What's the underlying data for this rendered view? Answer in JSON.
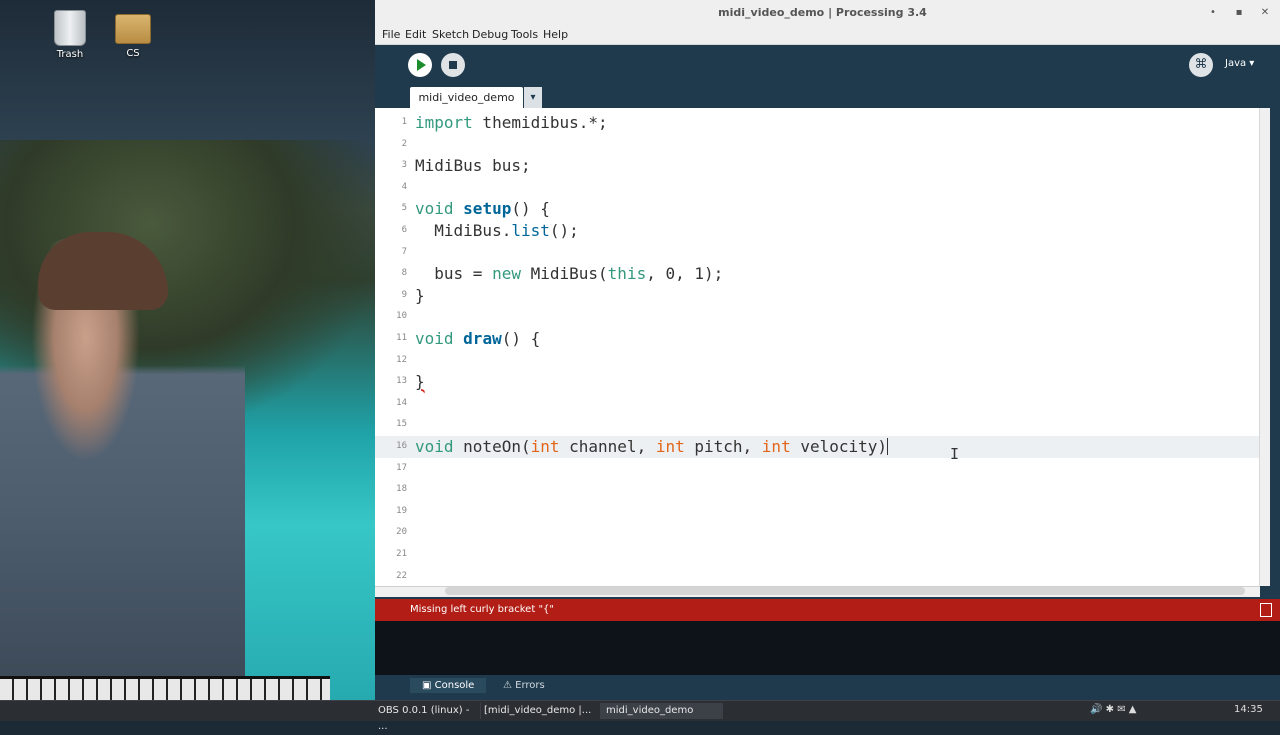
{
  "desktop": {
    "icons": [
      {
        "label": "Trash",
        "icon": "trash-icon"
      },
      {
        "label": "CS",
        "icon": "folder-icon"
      }
    ]
  },
  "window": {
    "title": "midi_video_demo | Processing 3.4",
    "menu": [
      "File",
      "Edit",
      "Sketch",
      "Debug",
      "Tools",
      "Help"
    ],
    "mode": "Java ▾",
    "tab": "midi_video_demo",
    "tab_menu": "▾"
  },
  "editor": {
    "lines": [
      {
        "n": "1",
        "tokens": [
          {
            "t": "import",
            "c": "kw"
          },
          {
            "t": " themidibus.*;",
            "c": "plain"
          }
        ]
      },
      {
        "n": "2",
        "tokens": []
      },
      {
        "n": "3",
        "tokens": [
          {
            "t": "MidiBus bus;",
            "c": "plain"
          }
        ]
      },
      {
        "n": "4",
        "tokens": []
      },
      {
        "n": "5",
        "tokens": [
          {
            "t": "void",
            "c": "kw"
          },
          {
            "t": " ",
            "c": "plain"
          },
          {
            "t": "setup",
            "c": "fn"
          },
          {
            "t": "() {",
            "c": "plain"
          }
        ]
      },
      {
        "n": "6",
        "tokens": [
          {
            "t": "  MidiBus.",
            "c": "plain"
          },
          {
            "t": "list",
            "c": "fn2"
          },
          {
            "t": "();",
            "c": "plain"
          }
        ]
      },
      {
        "n": "7",
        "tokens": []
      },
      {
        "n": "8",
        "tokens": [
          {
            "t": "  bus = ",
            "c": "plain"
          },
          {
            "t": "new",
            "c": "kw"
          },
          {
            "t": " MidiBus(",
            "c": "plain"
          },
          {
            "t": "this",
            "c": "kw"
          },
          {
            "t": ", 0, 1);",
            "c": "plain"
          }
        ]
      },
      {
        "n": "9",
        "tokens": [
          {
            "t": "}",
            "c": "plain"
          }
        ]
      },
      {
        "n": "10",
        "tokens": []
      },
      {
        "n": "11",
        "tokens": [
          {
            "t": "void",
            "c": "kw"
          },
          {
            "t": " ",
            "c": "plain"
          },
          {
            "t": "draw",
            "c": "fn"
          },
          {
            "t": "() {",
            "c": "plain"
          }
        ]
      },
      {
        "n": "12",
        "tokens": []
      },
      {
        "n": "13",
        "tokens": [
          {
            "t": "}",
            "c": "err"
          }
        ]
      },
      {
        "n": "14",
        "tokens": []
      },
      {
        "n": "15",
        "tokens": []
      },
      {
        "n": "16",
        "tokens": [
          {
            "t": "void",
            "c": "kw"
          },
          {
            "t": " noteOn(",
            "c": "plain"
          },
          {
            "t": "int",
            "c": "type"
          },
          {
            "t": " channel, ",
            "c": "plain"
          },
          {
            "t": "int",
            "c": "type"
          },
          {
            "t": " pitch, ",
            "c": "plain"
          },
          {
            "t": "int",
            "c": "type"
          },
          {
            "t": " velocity)",
            "c": "plain"
          }
        ],
        "current": true
      },
      {
        "n": "17",
        "tokens": []
      },
      {
        "n": "18",
        "tokens": []
      },
      {
        "n": "19",
        "tokens": []
      },
      {
        "n": "20",
        "tokens": []
      },
      {
        "n": "21",
        "tokens": []
      },
      {
        "n": "22",
        "tokens": []
      }
    ]
  },
  "status": {
    "message": "Missing left curly bracket \"{\""
  },
  "console_tabs": [
    "Console",
    "Errors"
  ],
  "taskbar": {
    "items": [
      "OBS 0.0.1 (linux) - ...",
      "[midi_video_demo |...",
      "midi_video_demo"
    ],
    "clock": "14:35"
  },
  "colors": {
    "keyword": "#33997e",
    "function": "#006699",
    "type": "#e2661a",
    "error_bar": "#b21d15",
    "chrome": "#1e3a4c"
  }
}
